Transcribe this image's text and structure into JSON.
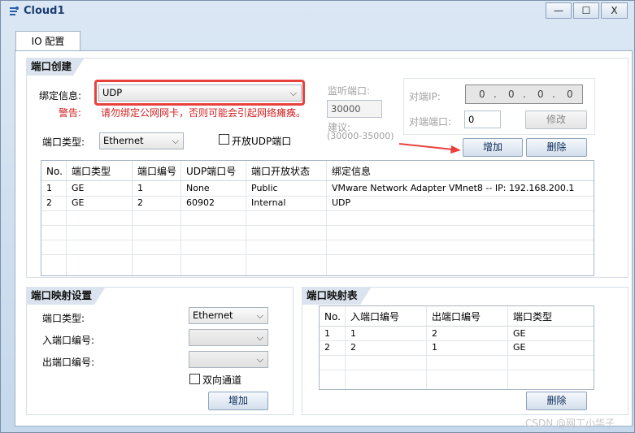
{
  "window": {
    "title": "Cloud1",
    "minimize_label": "—",
    "maximize_label": "☐",
    "close_label": "X"
  },
  "tabs": [
    {
      "label": "IO 配置"
    }
  ],
  "port_create": {
    "section_title": "端口创建",
    "bind_label": "绑定信息:",
    "bind_value": "UDP",
    "warning_label": "警告:",
    "warning_text": "请勿绑定公网网卡，否则可能会引起网络瘫痪。",
    "port_type_label": "端口类型:",
    "port_type_value": "Ethernet",
    "open_udp_label": "开放UDP端口",
    "open_udp_checked": false,
    "listen_port_label": "监听端口:",
    "listen_port_value": "30000",
    "suggest_label": "建议:",
    "suggest_range": "(30000-35000)",
    "peer_ip_label": "对端IP:",
    "peer_ip": [
      "0",
      "0",
      "0",
      "0"
    ],
    "peer_port_label": "对端端口:",
    "peer_port_value": "0",
    "modify_button": "修改",
    "add_button": "增加",
    "delete_button": "删除",
    "columns": [
      "No.",
      "端口类型",
      "端口编号",
      "UDP端口号",
      "端口开放状态",
      "绑定信息"
    ],
    "rows": [
      [
        "1",
        "GE",
        "1",
        "None",
        "Public",
        "VMware Network Adapter VMnet8 -- IP: 192.168.200.1"
      ],
      [
        "2",
        "GE",
        "2",
        "60902",
        "Internal",
        "UDP"
      ]
    ]
  },
  "port_mapping": {
    "section_title": "端口映射设置",
    "port_type_label": "端口类型:",
    "port_type_value": "Ethernet",
    "in_port_label": "入端口编号:",
    "in_port_value": "",
    "out_port_label": "出端口编号:",
    "out_port_value": "",
    "bidirectional_label": "双向通道",
    "bidirectional_checked": false,
    "add_button": "增加"
  },
  "mapping_table": {
    "section_title": "端口映射表",
    "columns": [
      "No.",
      "入端口编号",
      "出端口编号",
      "端口类型"
    ],
    "rows": [
      [
        "1",
        "1",
        "2",
        "GE"
      ],
      [
        "2",
        "2",
        "1",
        "GE"
      ]
    ],
    "delete_button": "删除"
  },
  "watermark": "CSDN @网工小华子",
  "colors": {
    "highlight": "#e8413c",
    "warning": "#d21f1f",
    "window_bg": "#c9dcef"
  }
}
